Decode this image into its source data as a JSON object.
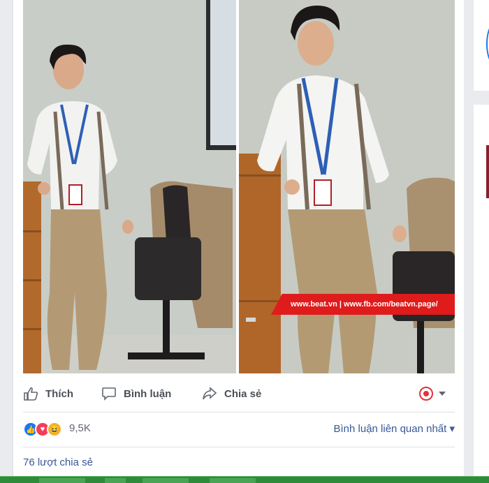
{
  "post": {
    "watermark": "www.beat.vn | www.fb.com/beatvn.page/",
    "actions": {
      "like": "Thích",
      "comment": "Bình luận",
      "share": "Chia sẻ"
    },
    "reactions": {
      "icons": [
        "like-icon",
        "love-icon",
        "haha-icon"
      ],
      "count": "9,5K"
    },
    "comment_sort": "Bình luận liên quan nhất ▾",
    "shares": "76 lượt chia sẻ"
  },
  "colors": {
    "link": "#385898",
    "action_text": "#4b4f56",
    "like_blue": "#1877f2",
    "love_red": "#f33e58",
    "haha_yellow": "#f7b125",
    "watermark_red": "#e01b1b"
  }
}
